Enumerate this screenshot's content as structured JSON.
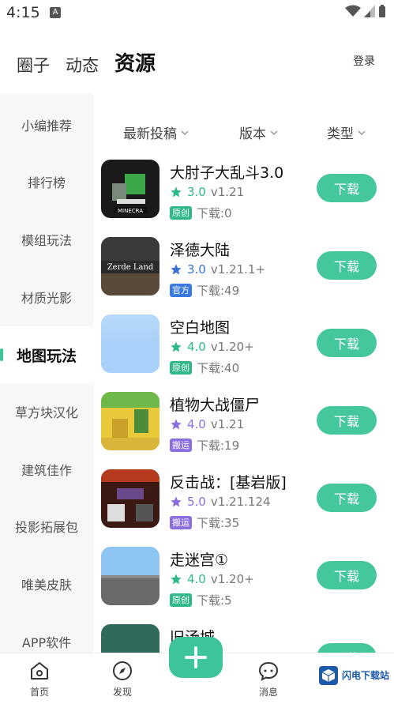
{
  "status": {
    "time": "4:15",
    "notif_letter": "A"
  },
  "header": {
    "tabs": [
      {
        "label": "圈子"
      },
      {
        "label": "动态"
      },
      {
        "label": "资源"
      }
    ],
    "login_label": "登录"
  },
  "sidebar": {
    "items": [
      {
        "label": "小编推荐"
      },
      {
        "label": "排行榜"
      },
      {
        "label": "模组玩法"
      },
      {
        "label": "材质光影"
      },
      {
        "label": "地图玩法"
      },
      {
        "label": "草方块汉化"
      },
      {
        "label": "建筑佳作"
      },
      {
        "label": "投影拓展包"
      },
      {
        "label": "唯美皮肤"
      },
      {
        "label": "APP软件"
      }
    ],
    "active_index": 4
  },
  "filters": [
    {
      "label": "最新投稿"
    },
    {
      "label": "版本"
    },
    {
      "label": "类型"
    }
  ],
  "items": [
    {
      "title": "大肘子大乱斗3.0",
      "star": "star-icon",
      "star_color": "#2fb88a",
      "score": "3.0",
      "score_color": "#2fb88a",
      "version": "v1.21",
      "tag": "原创",
      "tag_color": "#2fb88a",
      "downloads": "下载:0",
      "button": "下载"
    },
    {
      "title": "泽德大陆",
      "star": "star-icon",
      "star_color": "#3a6fd8",
      "score": "3.0",
      "score_color": "#3a6fd8",
      "version": "v1.21.1+",
      "tag": "官方",
      "tag_color": "#3a7ae0",
      "downloads": "下载:49",
      "button": "下载"
    },
    {
      "title": "空白地图",
      "star": "star-icon",
      "star_color": "#2fb88a",
      "score": "4.0",
      "score_color": "#2fb88a",
      "version": "v1.20+",
      "tag": "原创",
      "tag_color": "#2fb88a",
      "downloads": "下载:40",
      "button": "下载"
    },
    {
      "title": "植物大战僵尸",
      "star": "star-icon",
      "star_color": "#8a6ee0",
      "score": "4.0",
      "score_color": "#8a6ee0",
      "version": "v1.21",
      "tag": "搬运",
      "tag_color": "#8a6ee0",
      "downloads": "下载:19",
      "button": "下载"
    },
    {
      "title": "反击战：[基岩版]",
      "star": "star-icon",
      "star_color": "#8a6ee0",
      "score": "5.0",
      "score_color": "#8a6ee0",
      "version": "v1.21.124",
      "tag": "搬运",
      "tag_color": "#8a6ee0",
      "downloads": "下载:35",
      "button": "下载"
    },
    {
      "title": "走迷宫①",
      "star": "star-icon",
      "star_color": "#2fb88a",
      "score": "4.0",
      "score_color": "#2fb88a",
      "version": "v1.20+",
      "tag": "原创",
      "tag_color": "#2fb88a",
      "downloads": "下载:5",
      "button": "下载"
    },
    {
      "title": "旧汤城",
      "star": "star-icon",
      "star_color": "#2fb88a",
      "score": "",
      "score_color": "#2fb88a",
      "version": "",
      "tag": "",
      "tag_color": "#2fb88a",
      "downloads": "",
      "button": "下载"
    }
  ],
  "bottom_nav": [
    {
      "label": "首页",
      "icon": "home-icon"
    },
    {
      "label": "发现",
      "icon": "compass-icon"
    },
    {
      "label": "消息",
      "icon": "chat-icon"
    }
  ],
  "watermark": {
    "name": "闪电下载站"
  }
}
